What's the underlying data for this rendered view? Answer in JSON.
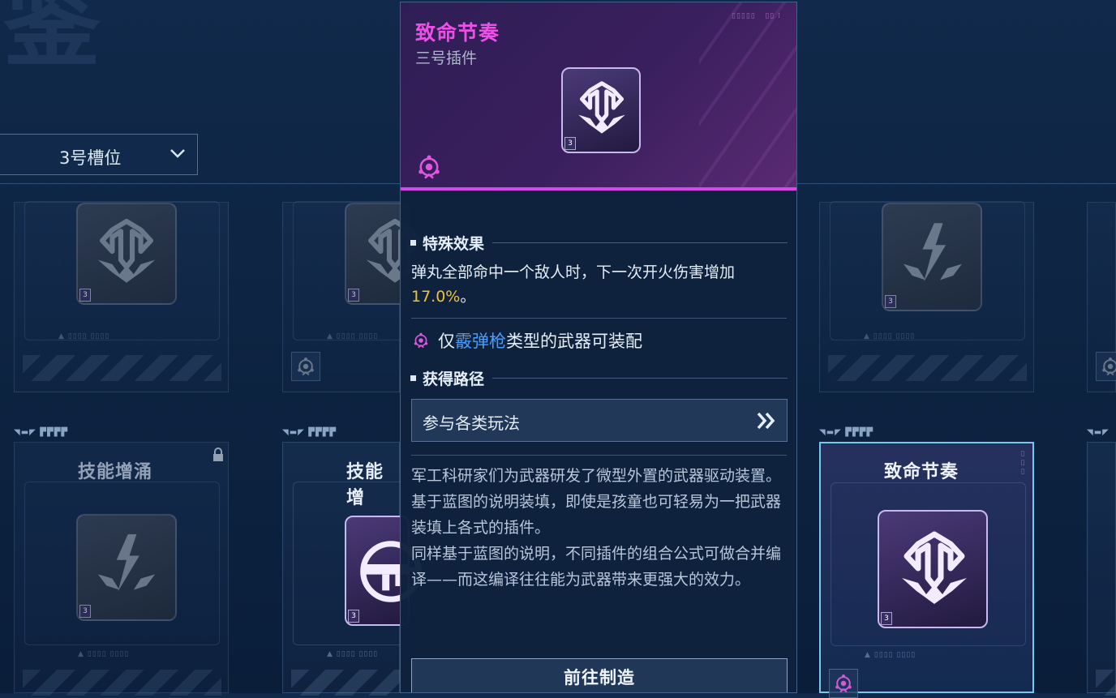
{
  "background": {
    "glyph": "鉴"
  },
  "slot_selector": {
    "label": "3号槽位",
    "icon": "chevron-down-icon"
  },
  "cards_top": [
    {
      "icon": "plugin-emblem-icon",
      "level": "3"
    },
    {
      "icon": "plugin-emblem-icon",
      "level": "3",
      "weapon_badge": "shotgun-type-icon"
    },
    {
      "icon": "plugin-emblem-icon",
      "level": "3"
    }
  ],
  "cards_bottom": [
    {
      "title": "技能增涌",
      "level": "3",
      "locked": true,
      "icon": "plugin-emblem-icon"
    },
    {
      "title": "技能增",
      "level": "3",
      "icon": "gun-plugin-icon"
    },
    {
      "title": "致命节奏",
      "level": "3",
      "selected": true,
      "icon": "plugin-emblem-icon",
      "weapon_badge": "shotgun-type-icon"
    }
  ],
  "popup": {
    "title": "致命节奏",
    "subtitle": "三号插件",
    "level": "3",
    "section_effect": "特殊效果",
    "effect_text": "弹丸全部命中一个敌人时，下一次开火伤害增加",
    "effect_value": "17.0%",
    "effect_suffix": "。",
    "weapon_prefix": "仅",
    "weapon_type": "霰弹枪",
    "weapon_suffix": "类型的武器可装配",
    "section_source": "获得路径",
    "route_label": "参与各类玩法",
    "lore": "军工科研家们为武器研发了微型外置的武器驱动装置。\n基于蓝图的说明装填，即使是孩童也可轻易为一把武器装填上各式的插件。\n同样基于蓝图的说明，不同插件的组合公式可做合并编译——而这编译往往能为武器带来更强大的效力。",
    "make_button": "前往制造"
  },
  "colors": {
    "accent_magenta": "#ee4fe6",
    "highlight_value": "#f3c232",
    "weapon_type_blue": "#4a9cff",
    "selected_border": "#79c7f0"
  }
}
